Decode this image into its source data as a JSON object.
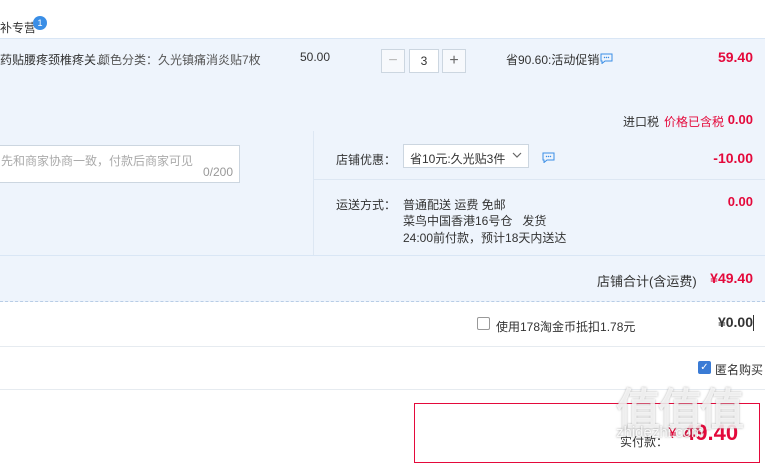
{
  "store": {
    "name": "补专营",
    "badge": "1"
  },
  "item": {
    "title": "药贴腰疼颈椎疼关...",
    "sku": "颜色分类：久光镇痛消炎贴7枚",
    "unit_price": "50.00",
    "qty_minus": "−",
    "quantity": "3",
    "qty_plus": "+",
    "promo": "省90.60:活动促销",
    "total": "59.40",
    "tax_label": "进口税",
    "tax_note": "价格已含税",
    "tax_value": "0.00"
  },
  "options": {
    "message_placeholder": "先和商家协商一致，付款后商家可见",
    "message_count": "0/200",
    "coupon_label": "店铺优惠：",
    "coupon_selected": "省10元:久光贴3件",
    "coupon_value": "-10.00",
    "shipping_label": "运送方式：",
    "shipping_method": "普通配送 运费 免邮",
    "shipping_warehouse_name": "菜鸟中国香港16号仓",
    "shipping_warehouse_action": "发货",
    "shipping_time": "24:00前付款，预计18天内送达",
    "shipping_value": "0.00"
  },
  "subtotal": {
    "label": "店铺合计(含运费)",
    "value": "¥49.40"
  },
  "coins": {
    "label": "使用178淘金币抵扣1.78元",
    "value": "¥0.00"
  },
  "anonymous": {
    "label": "匿名购买",
    "checked": true
  },
  "payment": {
    "label": "实付款：",
    "currency": "¥",
    "value": "49.40"
  },
  "watermark": {
    "glyphs": "值值值",
    "url": "zhidezhi.com"
  },
  "colors": {
    "accent_red": "#e4093b",
    "accent_blue": "#3a8ee6",
    "panel_bg": "#eef4fc"
  }
}
